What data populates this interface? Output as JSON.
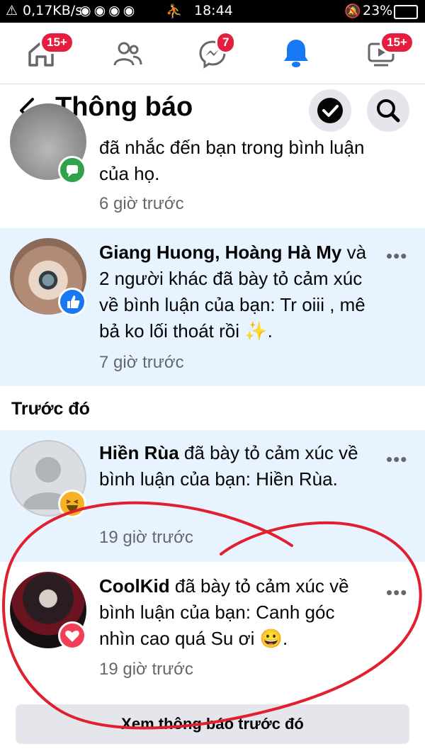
{
  "status_bar": {
    "speed": "0,17KB/s",
    "time": "18:44",
    "battery": "23%"
  },
  "nav": {
    "home_badge": "15+",
    "messenger_badge": "7",
    "watch_badge": "15+"
  },
  "header": {
    "title": "Thông báo"
  },
  "notifications": [
    {
      "text": "đã nhắc đến bạn trong bình luận của họ.",
      "time": "6 giờ trước",
      "reaction_icon": "comment-icon",
      "reaction_color": "#31a24c"
    },
    {
      "names": "Giang Huong, Hoàng Hà My",
      "text": "và 2 người khác đã bày tỏ cảm xúc về bình luận của bạn: Tr oiii , mê bả ko lối thoát rồi",
      "emoji": "✨",
      "trailing": ".",
      "time": "7 giờ trước",
      "reaction_icon": "like-icon",
      "reaction_color": "#1877f2"
    }
  ],
  "section_title": "Trước đó",
  "earlier": [
    {
      "name": "Hiền Rùa",
      "text": "đã bày tỏ cảm xúc về bình luận của bạn: Hiền Rùa.",
      "time": "19 giờ trước",
      "reaction_icon": "haha-icon",
      "reaction_color": "#f7b125"
    },
    {
      "name": "CoolKid",
      "text": "đã bày tỏ cảm xúc về bình luận của bạn: Canh góc nhìn cao quá Su ơi",
      "emoji": "😀",
      "trailing": ".",
      "time": "19 giờ trước",
      "reaction_icon": "love-icon",
      "reaction_color": "#f33e58"
    }
  ],
  "see_more_label": "Xem thông báo trước đó",
  "colors": {
    "accent": "#1877f2",
    "unread_bg": "#e7f3ff",
    "scribble": "#e0202e"
  }
}
